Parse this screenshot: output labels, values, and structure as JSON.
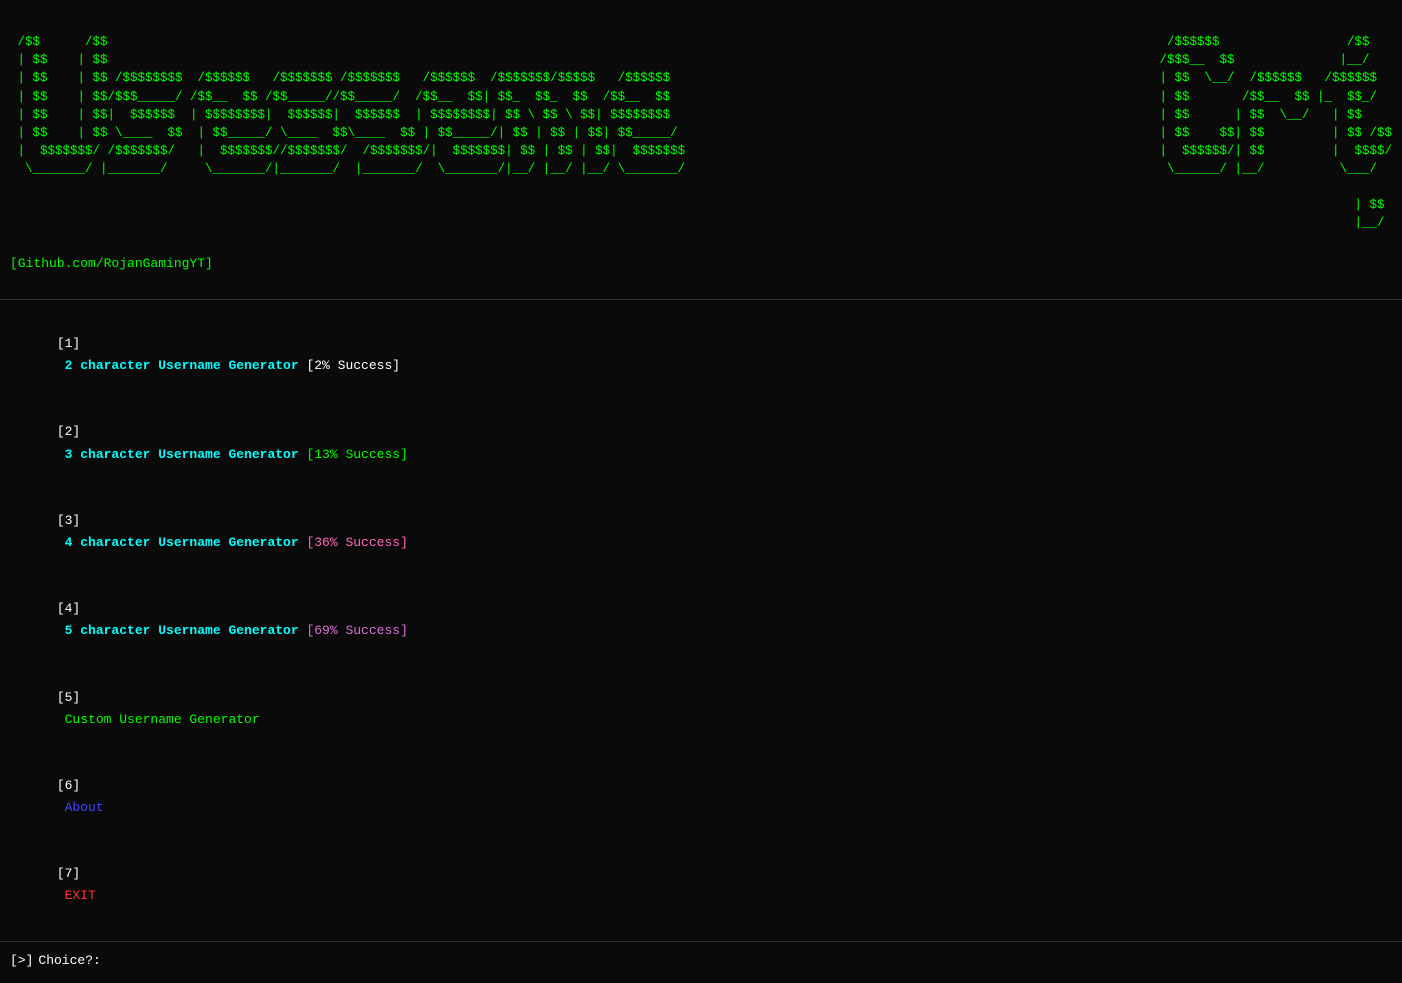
{
  "terminal": {
    "ascii_left_lines": [
      " /$$      /$$                                                                                                                  ",
      " | $$    | $$                                                                                                                  ",
      " | $$    | $$ /$$$$$$$   /$$$$$$   /$$$$$$$ /$$$$$$$   /$$$$$$ /$$$$$$$/$$$$$   /$$$$$$                                      ",
      " | $$    | $$/$$$____/  /$$__  $$ /$$_____//$$_____/  /$$__  $| $$_  $$_  $$  /$$__  $$                                     ",
      " | $$    | $$$  \\$$$$$$| $$$$$$$$|  $$$$$$|  $$$$$$  | $$$$$$$$| $$ \\ $$ \\ $$| $$$$$$$$                                  ",
      " | $$    | $$  \\____  $$| $$_____/ \\____  $$\\____  $$ | $$_____/| $$ | $$ | $$| $$_____/                                 ",
      " |  $$$$$$$/ /$$$$$$$/  |  $$$$$$$ /$$$$$$$/ /$$$$$$$/  |  $$$$$$$| $$ | $$ | $$|  $$$$$$$                                  ",
      "  \\_______/ |_______/    \\_______/|_______/ |_______/    \\_______/|__/ |__/ |__/ \\_______/                              "
    ],
    "ascii_right_lines": [
      " /$$$$$$                /$$  ",
      "/$$__  $$              |__/  ",
      "| $$  \\__/  /$$$$$$  /$$$$$$  ",
      "| $$       /$$__  $$|_  $$_/  ",
      "| $$      | $$  \\__/  | $$    ",
      "| $$    $$| $$        | $$ /$$",
      "|  $$$$$$/| $$        |  $$$$/",
      " \\______/ |__/         \\___/  ",
      "                              ",
      "                        | $$  ",
      "                        |__/  "
    ],
    "github_text": "[Github.com/RojanGamingYT]",
    "menu_items": [
      {
        "num": "1",
        "text": "2 character Username Generator ",
        "success": "[2% Success]",
        "num_color": "white",
        "text_color": "cyan",
        "success_color": "white"
      },
      {
        "num": "2",
        "text": "3 character Username Generator ",
        "success": "[13% Success]",
        "num_color": "white",
        "text_color": "cyan",
        "success_color": "green"
      },
      {
        "num": "3",
        "text": "4 character Username Generator ",
        "success": "[36% Success]",
        "num_color": "white",
        "text_color": "cyan",
        "success_color": "pink"
      },
      {
        "num": "4",
        "text": "5 character Username Generator ",
        "success": "[69% Success]",
        "num_color": "white",
        "text_color": "cyan",
        "success_color": "purple"
      },
      {
        "num": "5",
        "text": "Custom Username Generator",
        "success": "",
        "num_color": "white",
        "text_color": "green",
        "success_color": ""
      },
      {
        "num": "6",
        "text": "About",
        "success": "",
        "num_color": "white",
        "text_color": "blue",
        "success_color": ""
      },
      {
        "num": "7",
        "text": "EXIT",
        "success": "",
        "num_color": "white",
        "text_color": "red",
        "success_color": ""
      }
    ],
    "prompt": {
      "symbol": "[>]",
      "label": "Choice?: "
    }
  }
}
